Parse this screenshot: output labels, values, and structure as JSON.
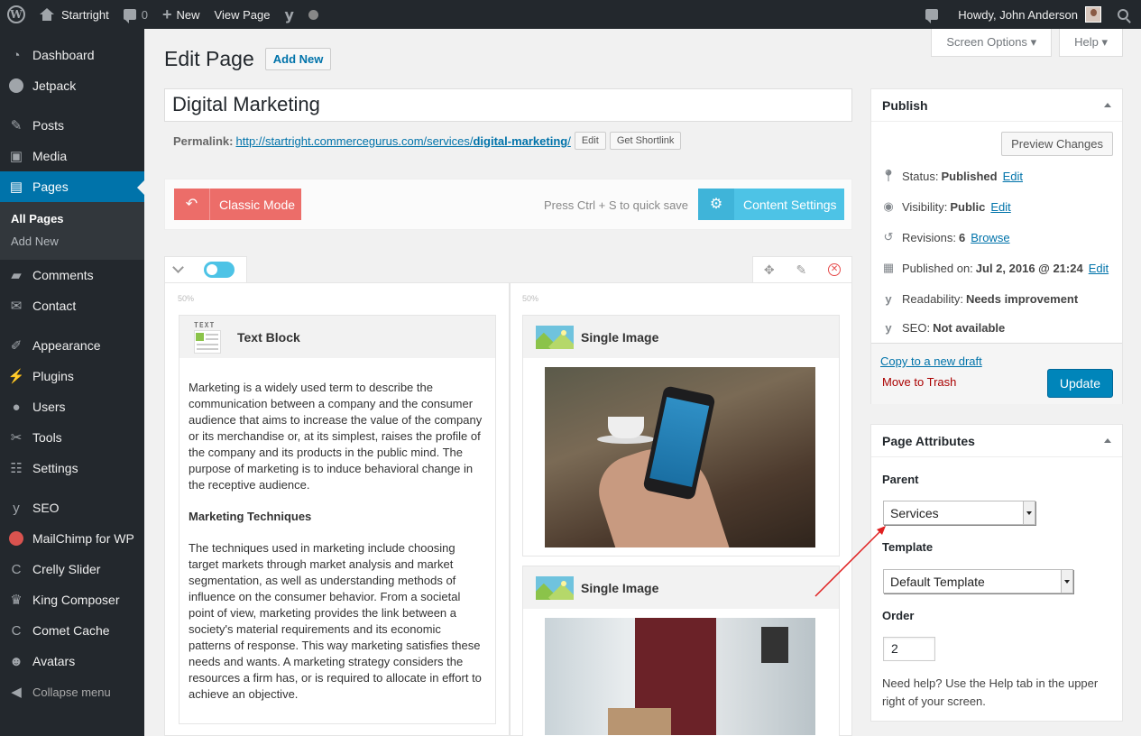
{
  "adminbar": {
    "site_name": "Startright",
    "comments_count": "0",
    "new_label": "New",
    "view_page_label": "View Page",
    "howdy": "Howdy, John Anderson"
  },
  "sidebar": {
    "items": [
      {
        "label": "Dashboard",
        "icon": "dashboard-icon"
      },
      {
        "label": "Jetpack",
        "icon": "jetpack-icon"
      },
      {
        "label": "Posts",
        "icon": "pin-icon"
      },
      {
        "label": "Media",
        "icon": "media-icon"
      },
      {
        "label": "Pages",
        "icon": "pages-icon"
      },
      {
        "label": "Comments",
        "icon": "comments-icon"
      },
      {
        "label": "Contact",
        "icon": "mail-icon"
      },
      {
        "label": "Appearance",
        "icon": "brush-icon"
      },
      {
        "label": "Plugins",
        "icon": "plugin-icon"
      },
      {
        "label": "Users",
        "icon": "user-icon"
      },
      {
        "label": "Tools",
        "icon": "wrench-icon"
      },
      {
        "label": "Settings",
        "icon": "settings-icon"
      },
      {
        "label": "SEO",
        "icon": "yoast-icon"
      },
      {
        "label": "MailChimp for WP",
        "icon": "mailchimp-icon"
      },
      {
        "label": "Crelly Slider",
        "icon": "crelly-icon"
      },
      {
        "label": "King Composer",
        "icon": "crown-icon"
      },
      {
        "label": "Comet Cache",
        "icon": "comet-icon"
      },
      {
        "label": "Avatars",
        "icon": "ninja-icon"
      }
    ],
    "submenu": [
      "All Pages",
      "Add New"
    ],
    "collapse_label": "Collapse menu"
  },
  "screen_meta": {
    "screen_options": "Screen Options",
    "help": "Help"
  },
  "header": {
    "title": "Edit Page",
    "add_new": "Add New"
  },
  "post": {
    "title": "Digital Marketing",
    "permalink_label": "Permalink:",
    "permalink_url": "http://startright.commercegurus.com/services/",
    "permalink_slug": "digital-marketing",
    "permalink_tail": "/",
    "edit_btn": "Edit",
    "shortlink_btn": "Get Shortlink"
  },
  "composer": {
    "classic_mode": "Classic Mode",
    "quick_save": "Press Ctrl + S to quick save",
    "content_settings": "Content Settings",
    "col_pct_1": "50%",
    "col_pct_2": "50%",
    "text_icon_label": "TEXT",
    "text_block_title": "Text Block",
    "text_p1": "Marketing is a widely used term to describe the communication between a company and the consumer audience that aims to increase the value of the company or its merchandise or, at its simplest, raises the profile of the company and its products in the public mind. The purpose of marketing is to induce behavioral change in the receptive audience.",
    "text_heading": "Marketing Techniques",
    "text_p2": "The techniques used in marketing include choosing target markets through market analysis and market segmentation, as well as understanding methods of influence on the consumer behavior. From a societal point of view, marketing provides the link between a society's material requirements and its economic patterns of response. This way marketing satisfies these needs and wants. A marketing strategy considers the resources a firm has, or is required to allocate in effort to achieve an objective.",
    "single_image_title_1": "Single Image",
    "single_image_title_2": "Single Image"
  },
  "publish": {
    "title": "Publish",
    "preview_btn": "Preview Changes",
    "status_label": "Status:",
    "status_value": "Published",
    "visibility_label": "Visibility:",
    "visibility_value": "Public",
    "revisions_label": "Revisions:",
    "revisions_value": "6",
    "browse": "Browse",
    "published_on_label": "Published on:",
    "published_on_value": "Jul 2, 2016 @ 21:24",
    "readability_label": "Readability:",
    "readability_value": "Needs improvement",
    "seo_label": "SEO:",
    "seo_value": "Not available",
    "edit_link": "Edit",
    "copy_draft": "Copy to a new draft",
    "move_trash": "Move to Trash",
    "update_btn": "Update"
  },
  "attributes": {
    "title": "Page Attributes",
    "parent_label": "Parent",
    "parent_value": "Services",
    "template_label": "Template",
    "template_value": "Default Template",
    "order_label": "Order",
    "order_value": "2",
    "help_text": "Need help? Use the Help tab in the upper right of your screen."
  },
  "colors": {
    "admin_dark": "#23282d",
    "accent_blue": "#0073aa",
    "classic_red": "#ec6d69",
    "settings_cyan": "#4dc3e6",
    "annotation_arrow": "#e02020"
  }
}
